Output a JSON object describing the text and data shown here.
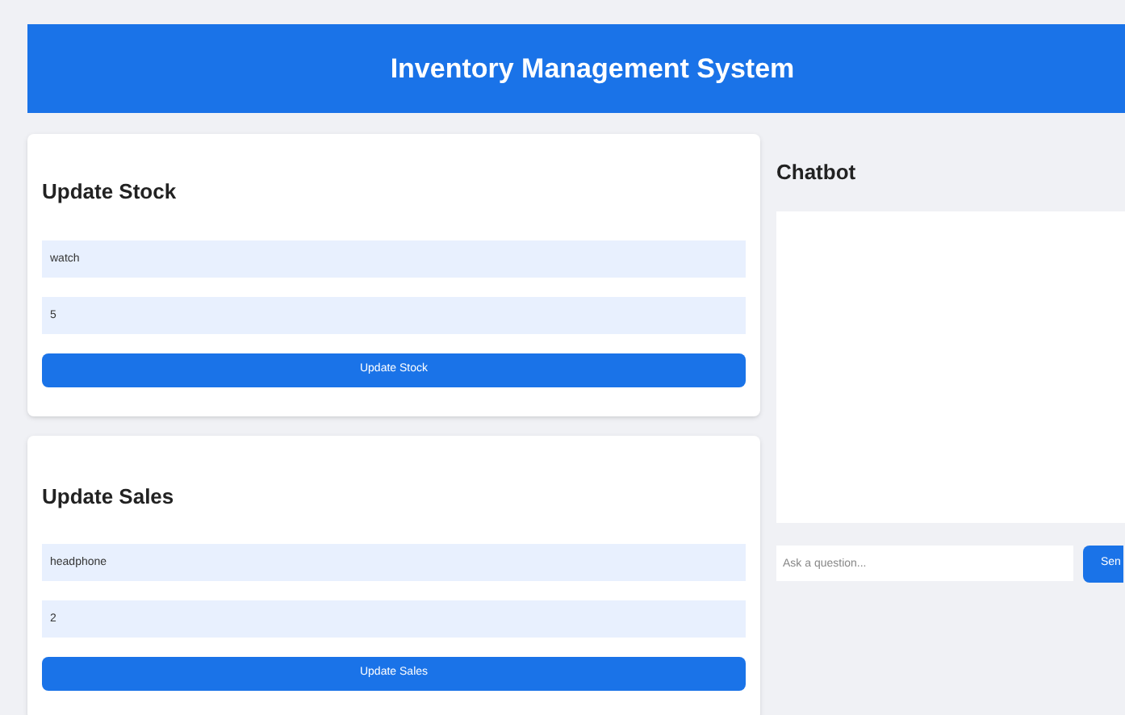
{
  "header": {
    "title": "Inventory Management System"
  },
  "forms": [
    {
      "title": "Update Stock",
      "fields": [
        {
          "value": "watch"
        },
        {
          "value": "5"
        }
      ],
      "button": "Update Stock"
    },
    {
      "title": "Update Sales",
      "fields": [
        {
          "value": "headphone"
        },
        {
          "value": "2"
        }
      ],
      "button": "Update Sales"
    }
  ],
  "chatbot": {
    "title": "Chatbot",
    "input": {
      "placeholder": "Ask a question..."
    },
    "button": "Sen"
  }
}
